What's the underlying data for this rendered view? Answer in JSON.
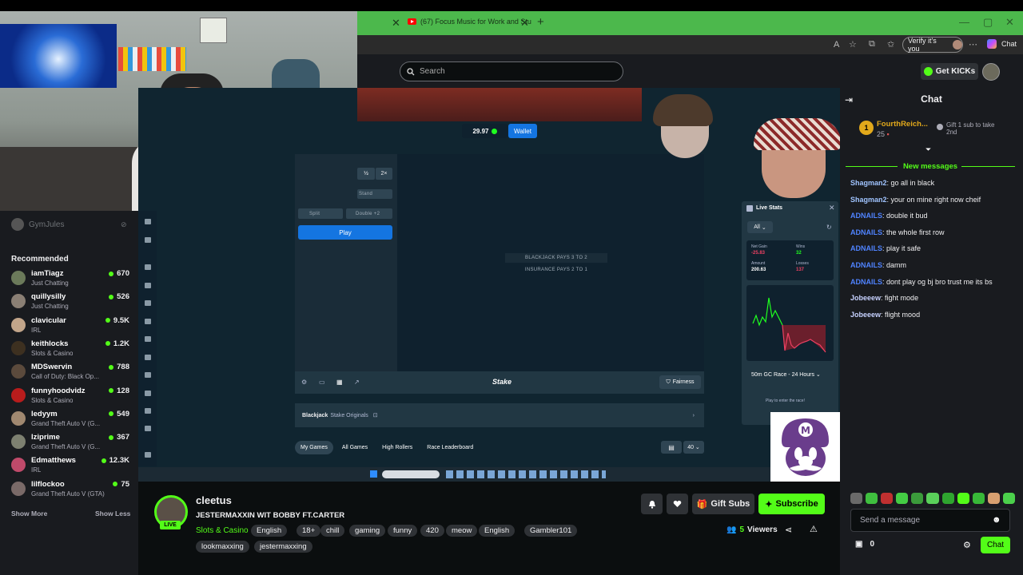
{
  "browser": {
    "tab_title": "(67) Focus Music for Work and Stu",
    "verify_label": "Verify it's you",
    "copilot_label": "Chat"
  },
  "header": {
    "search_placeholder": "Search",
    "get_kicks_label": "Get KICKs"
  },
  "game": {
    "balance": "29.97",
    "wallet_label": "Wallet",
    "half_label": "½",
    "double_label": "2×",
    "stand_label": "Stand",
    "split_label": "Split",
    "double_bet_label": "Double +2",
    "play_label": "Play",
    "pays_text": "BLACKJACK PAYS 3 TO 2",
    "insurance_text": "INSURANCE PAYS 2 TO 1",
    "stake_logo": "Stake",
    "fairness_label": "Fairness",
    "game_name": "Blackjack",
    "game_sub": "Stake Originals",
    "tabs": [
      "My Games",
      "All Games",
      "High Rollers",
      "Race Leaderboard"
    ],
    "page_size": "40"
  },
  "live_stats": {
    "title": "Live Stats",
    "filter": "All",
    "profit_label": "Net Gain",
    "profit": "-25.83",
    "wins_label": "Wins",
    "wins": "32",
    "amount_label": "Amount",
    "amount": "200.63",
    "losses_label": "Losses",
    "losses": "137",
    "race_label": "50m GC Race - 24 Hours",
    "race_enter": "Play to enter the race!"
  },
  "sidebar": {
    "following_user": "GymJules",
    "recommended_title": "Recommended",
    "items": [
      {
        "name": "iamTiagz",
        "category": "Just Chatting",
        "viewers": "670",
        "color": "#6b7a5a"
      },
      {
        "name": "quillysilly",
        "category": "Just Chatting",
        "viewers": "526",
        "color": "#8a7f74"
      },
      {
        "name": "clavicular",
        "category": "IRL",
        "viewers": "9.5K",
        "color": "#c2a58a"
      },
      {
        "name": "keithlocks",
        "category": "Slots & Casino",
        "viewers": "1.2K",
        "color": "#3d3020"
      },
      {
        "name": "MDSwervin",
        "category": "Call of Duty: Black Op...",
        "viewers": "788",
        "color": "#5b4a3c"
      },
      {
        "name": "funnyhoodvidz",
        "category": "Slots & Casino",
        "viewers": "128",
        "color": "#b81c1c"
      },
      {
        "name": "ledyym",
        "category": "Grand Theft Auto V (G...",
        "viewers": "549",
        "color": "#a08870"
      },
      {
        "name": "lziprime",
        "category": "Grand Theft Auto V (G...",
        "viewers": "367",
        "color": "#7d8070"
      },
      {
        "name": "Edmatthews",
        "category": "IRL",
        "viewers": "12.3K",
        "color": "#c04a6a"
      },
      {
        "name": "lilflockoo",
        "category": "Grand Theft Auto V (GTA)",
        "viewers": "75",
        "color": "#7a6a68"
      }
    ],
    "show_more": "Show More",
    "show_less": "Show Less"
  },
  "stream": {
    "channel": "cleetus",
    "live_badge": "LIVE",
    "title": "JESTERMAXXIN WIT BOBBY FT.CARTER",
    "category": "Slots & Casino",
    "tags": [
      "English",
      "18+",
      "chill",
      "gaming",
      "funny",
      "420",
      "meow",
      "English",
      "Gambler101",
      "lookmaxxing",
      "jestermaxxing"
    ],
    "gift_subs_label": "Gift Subs",
    "subscribe_label": "Subscribe",
    "viewers": "5",
    "viewers_label": "Viewers"
  },
  "chat": {
    "title": "Chat",
    "pinned_rank": "1",
    "pinned_user": "FourthReich...",
    "pinned_count": "25",
    "pinned_gift": "Gift 1 sub to take 2nd",
    "new_messages": "New messages",
    "messages": [
      {
        "user": "Shagman2",
        "text": "go all in black",
        "color": "#a0c4ff"
      },
      {
        "user": "Shagman2",
        "text": "your on mine right now cheif",
        "color": "#a0c4ff"
      },
      {
        "user": "ADNAILS",
        "text": "double it bud",
        "color": "#4f83ff"
      },
      {
        "user": "ADNAILS",
        "text": "the whole first row",
        "color": "#4f83ff"
      },
      {
        "user": "ADNAILS",
        "text": "play it safe",
        "color": "#4f83ff"
      },
      {
        "user": "ADNAILS",
        "text": "damm",
        "color": "#4f83ff"
      },
      {
        "user": "ADNAILS",
        "text": "dont play og bj bro trust me its bs",
        "color": "#4f83ff"
      },
      {
        "user": "Jobeeew",
        "text": "fight mode",
        "color": "#c7d2ff"
      },
      {
        "user": "Jobeeew",
        "text": "flight mood",
        "color": "#c7d2ff"
      }
    ],
    "input_placeholder": "Send a message",
    "kick_count": "0",
    "send_label": "Chat"
  },
  "colors": {
    "accent": "#53fc18",
    "stake_blue": "#1475e1"
  }
}
